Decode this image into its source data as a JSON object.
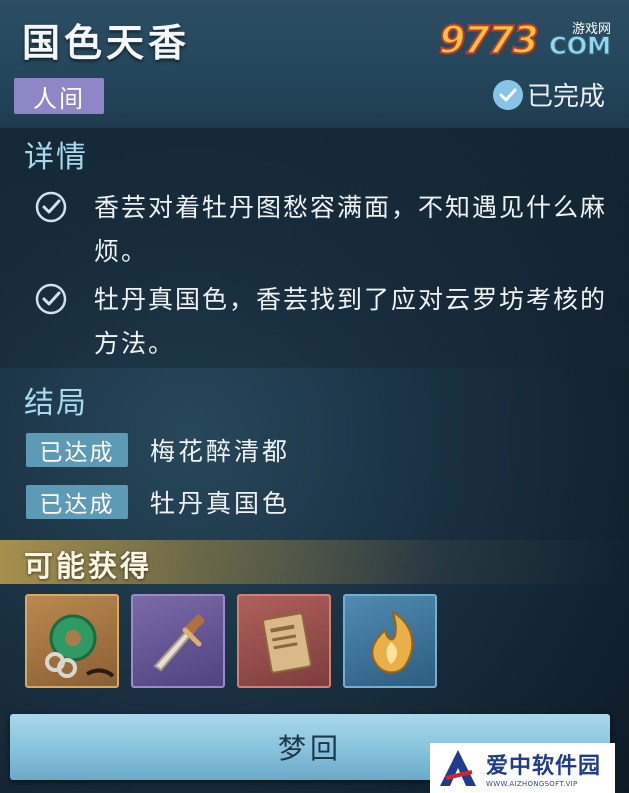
{
  "header": {
    "title": "国色天香",
    "realm_tag": "人间",
    "status": "已完成"
  },
  "watermark_top": {
    "number": "9773",
    "sub": "游戏网",
    "com": "COM"
  },
  "details": {
    "title": "详情",
    "items": [
      {
        "text": "香芸对着牡丹图愁容满面，不知遇见什么麻烦。",
        "checked": true
      },
      {
        "text": "牡丹真国色，香芸找到了应对云罗坊考核的方法。",
        "checked": true
      }
    ]
  },
  "endings": {
    "title": "结局",
    "items": [
      {
        "tag": "已达成",
        "name": "梅花醉清都"
      },
      {
        "tag": "已达成",
        "name": "牡丹真国色"
      }
    ]
  },
  "rewards": {
    "title": "可能获得",
    "items": [
      {
        "icon": "jade-pendant-icon",
        "frame_color": "#c99a5a"
      },
      {
        "icon": "dagger-icon",
        "frame_color": "#8a7bbd"
      },
      {
        "icon": "scroll-book-icon",
        "frame_color": "#c46b66"
      },
      {
        "icon": "golden-flame-icon",
        "frame_color": "#5e9bc2"
      }
    ]
  },
  "actions": {
    "dream_label": "梦回"
  },
  "watermark_bottom": {
    "cn": "爱中软件园",
    "en": "WWW.AIZHONGSOFT.VIP"
  }
}
